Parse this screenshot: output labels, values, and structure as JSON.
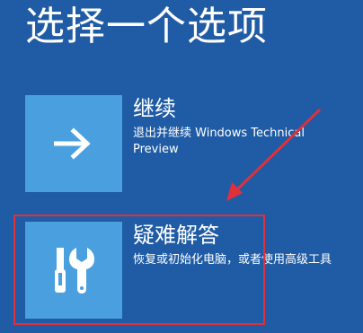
{
  "page_title": "选择一个选项",
  "options": [
    {
      "icon": "arrow-right-icon",
      "label": "继续",
      "description": "退出并继续 Windows Technical Preview"
    },
    {
      "icon": "tools-icon",
      "label": "疑难解答",
      "description": "恢复或初始化电脑，或者使用高级工具"
    }
  ],
  "colors": {
    "background": "#1f5ca5",
    "tile": "#4aa0de",
    "annotation": "#e0303a"
  }
}
